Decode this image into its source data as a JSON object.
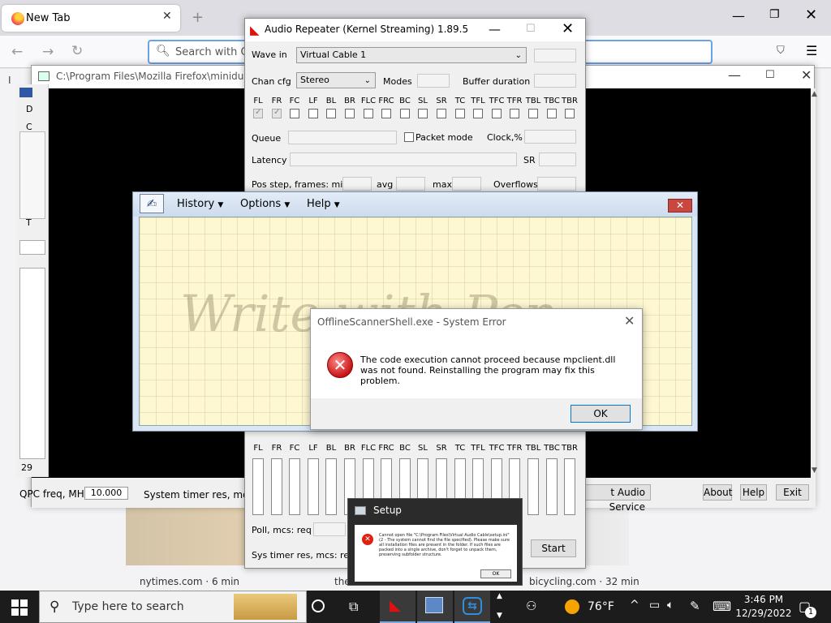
{
  "firefox": {
    "tab_title": "New Tab",
    "new_tab": "+",
    "search_placeholder": "Search with Go",
    "bookmark_initial": "I",
    "tiles": {
      "nytimes": "nytimes.com · 6 min",
      "the": "the",
      "bicycling": "bicycling.com · 32 min"
    }
  },
  "minidump": {
    "title": "C:\\Program Files\\Mozilla Firefox\\minidump-",
    "left_panel": {
      "d": "D",
      "c": "C",
      "t": "T",
      "val": "29"
    },
    "qpc_label": "QPC freq, MHz",
    "qpc_value": "10.000",
    "sys_timer_label": "System timer res, mcs",
    "audio_service_btn": "t Audio Service",
    "about_btn": "About",
    "help_btn": "Help",
    "exit_btn": "Exit"
  },
  "audio_repeater": {
    "title": "Audio Repeater (Kernel Streaming) 1.89.5",
    "wave_in_label": "Wave in",
    "wave_in_value": "Virtual Cable 1",
    "chan_cfg_label": "Chan cfg",
    "chan_cfg_value": "Stereo",
    "modes_label": "Modes",
    "buffer_duration_label": "Buffer duration",
    "channels": [
      "FL",
      "FR",
      "FC",
      "LF",
      "BL",
      "BR",
      "FLC",
      "FRC",
      "BC",
      "SL",
      "SR",
      "TC",
      "TFL",
      "TFC",
      "TFR",
      "TBL",
      "TBC",
      "TBR"
    ],
    "checked_channels": [
      true,
      true,
      false,
      false,
      false,
      false,
      false,
      false,
      false,
      false,
      false,
      false,
      false,
      false,
      false,
      false,
      false,
      false
    ],
    "queue_label": "Queue",
    "packet_mode_label": "Packet mode",
    "clock_label": "Clock,%",
    "latency_label": "Latency",
    "sr_label": "SR",
    "pos_step_label": "Pos step, frames:  min",
    "avg_label": "avg",
    "max_label": "max",
    "overflows_label": "Overflows",
    "poll_label": "Poll, mcs:  req",
    "sys_timer_label": "Sys timer res, mcs:  req",
    "start_btn": "Start"
  },
  "write_pen": {
    "menu": {
      "history": "History",
      "options": "Options",
      "help": "Help"
    },
    "watermark": "Write with Pen"
  },
  "error_dialog": {
    "title": "OfflineScannerShell.exe - System Error",
    "message": "The code execution cannot proceed because mpclient.dll was not found. Reinstalling the program may fix this problem.",
    "ok": "OK"
  },
  "setup": {
    "title": "Setup",
    "message": "Cannot open file \"C:\\Program Files\\Virtual Audio Cable\\setup.ini\" (2 - The system cannot find the file specified). Please make sure all installation files are present in the folder. If such files are packed into a single archive, don't forget to unpack them, preserving subfolder structure.",
    "ok": "OK"
  },
  "taskbar": {
    "search_text": "Type here to search",
    "weather": "76°F",
    "time": "3:46 PM",
    "date": "12/29/2022",
    "notification_count": "1"
  }
}
